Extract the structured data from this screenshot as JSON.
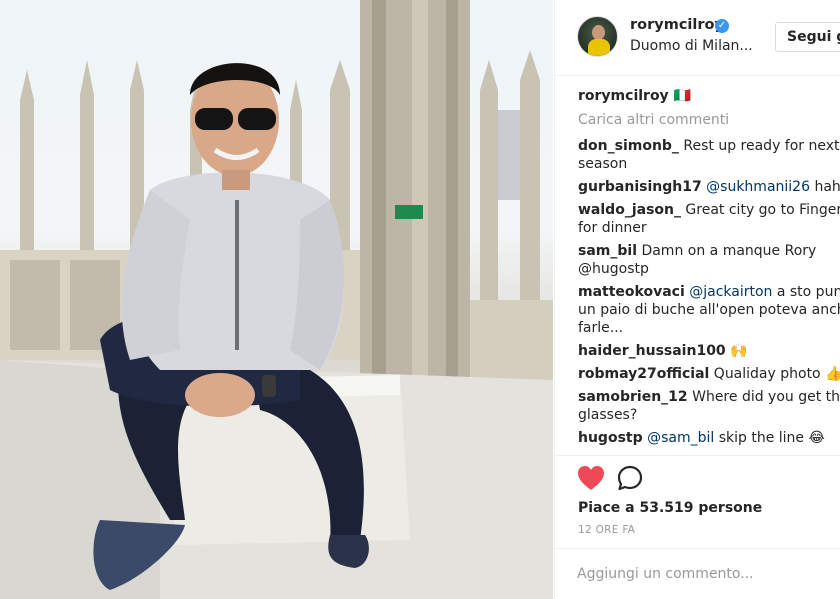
{
  "post": {
    "username": "rorymcilroy",
    "verified_icon": "verified-badge-icon",
    "location": "Duomo di Milan...",
    "follow_label": "Segui g",
    "caption_user": "rorymcilroy",
    "caption_text": "🇮🇹",
    "load_more": "Carica altri commenti",
    "likes": "Piace a 53.519 persone",
    "time": "12 ORE FA",
    "add_comment_placeholder": "Aggiungi un commento...",
    "accent_heart": "#ed4956"
  },
  "comments": [
    {
      "user": "don_simonb_",
      "mention": "",
      "text": " Rest up ready for next\nseason"
    },
    {
      "user": "gurbanisingh17",
      "mention": "@sukhmanii26",
      "text": " haha"
    },
    {
      "user": "waldo_jason_",
      "mention": "",
      "text": " Great city go to Fingers\nfor dinner"
    },
    {
      "user": "sam_bil",
      "mention": "",
      "text": " Damn on a manque Rory\n@hugostp"
    },
    {
      "user": "matteokovaci",
      "mention": "@jackairton",
      "text": " a sto punto\nun paio di buche all'open poteva anche\nfarle..."
    },
    {
      "user": "haider_hussain100",
      "mention": "",
      "text": " 🙌"
    },
    {
      "user": "robmay27official",
      "mention": "",
      "text": " Qualiday photo 👍👍"
    },
    {
      "user": "samobrien_12",
      "mention": "",
      "text": " Where did you get the\nglasses?"
    },
    {
      "user": "hugostp",
      "mention": "@sam_bil",
      "text": " skip the line 😂"
    }
  ]
}
